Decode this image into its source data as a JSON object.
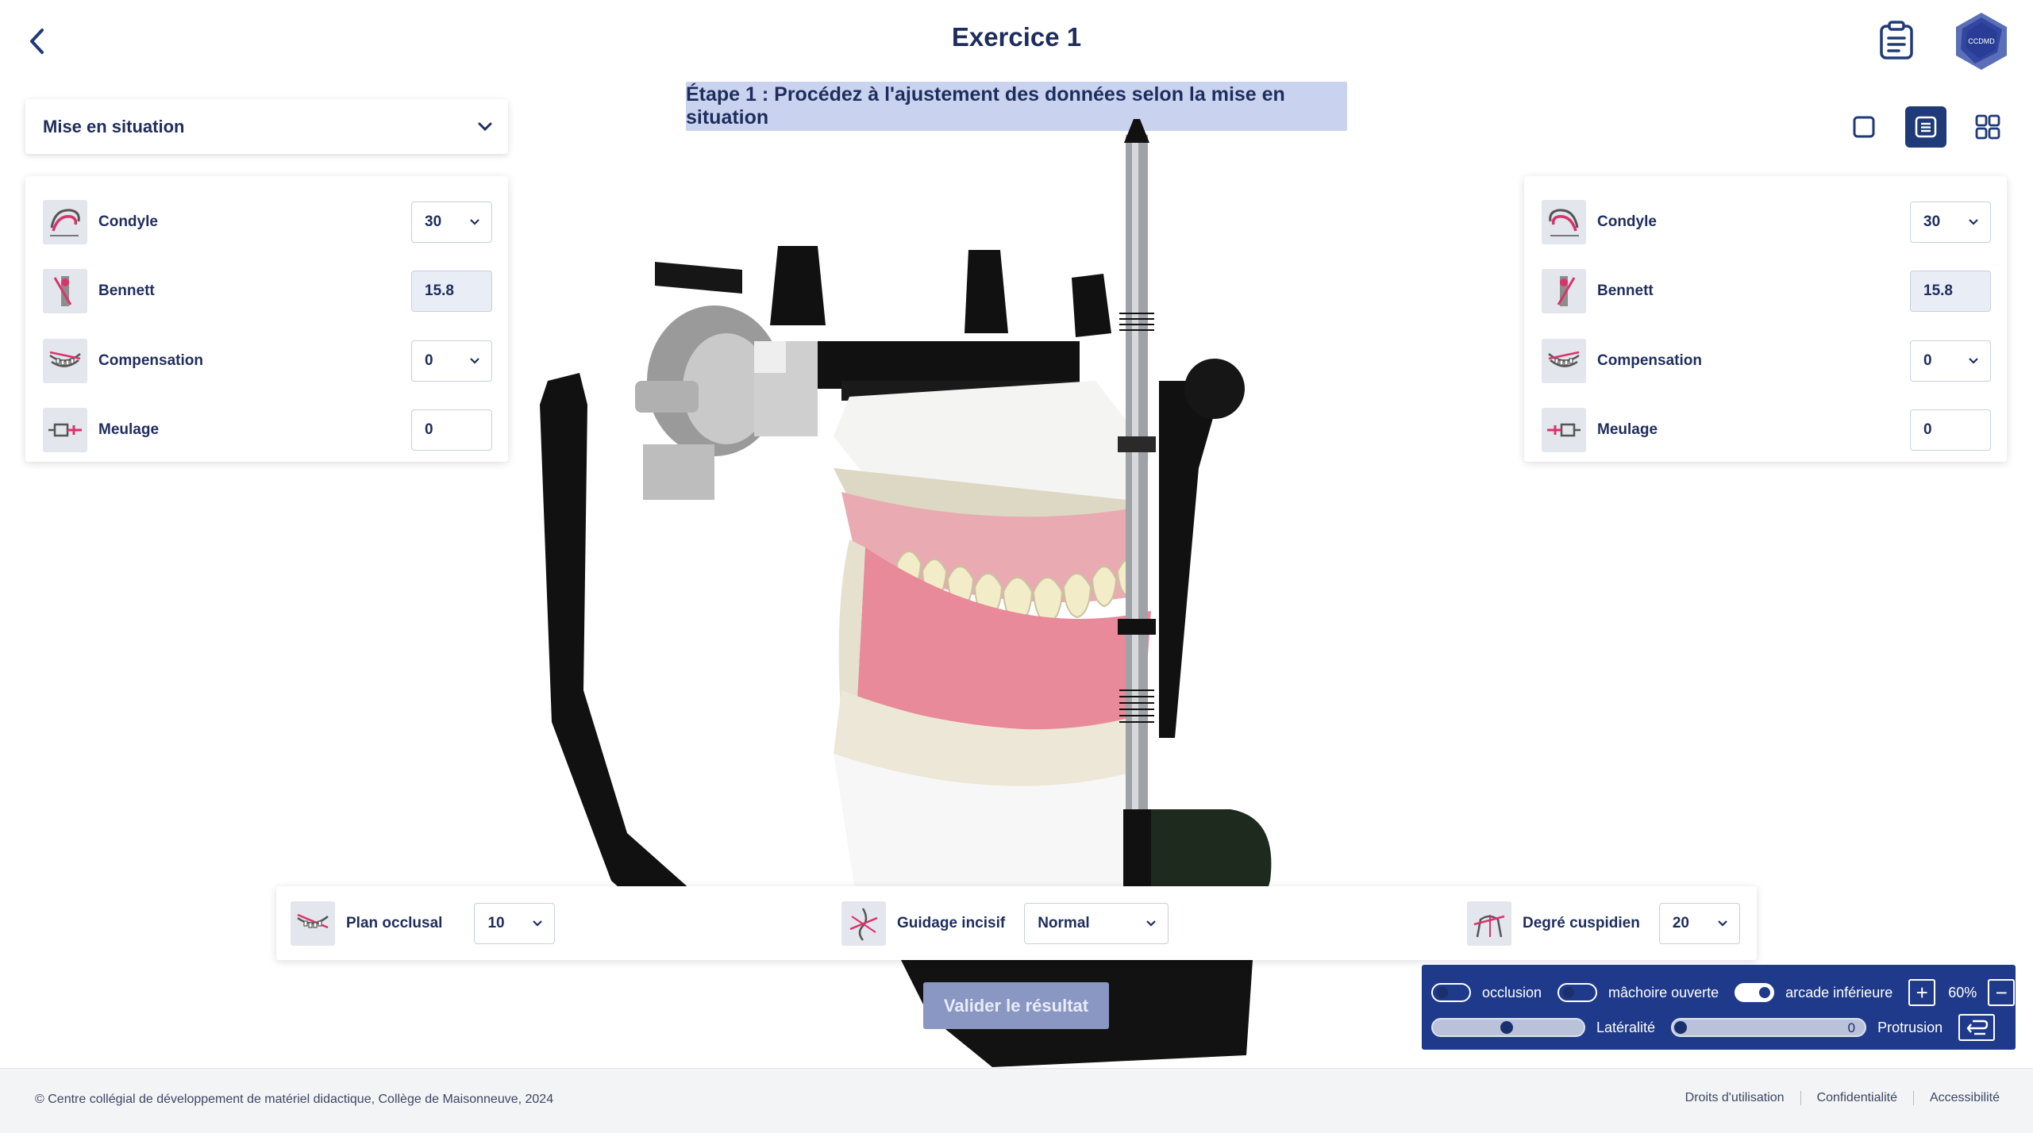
{
  "header": {
    "title": "Exercice 1",
    "logo_text": "CCDMD"
  },
  "step_banner": "Étape 1 : Procédez à l'ajustement des données selon la mise en situation",
  "situation_dropdown": {
    "label": "Mise en situation"
  },
  "left_panel": {
    "condyle": {
      "label": "Condyle",
      "value": "30"
    },
    "bennett": {
      "label": "Bennett",
      "value": "15.8"
    },
    "compensation": {
      "label": "Compensation",
      "value": "0"
    },
    "meulage": {
      "label": "Meulage",
      "value": "0"
    }
  },
  "right_panel": {
    "condyle": {
      "label": "Condyle",
      "value": "30"
    },
    "bennett": {
      "label": "Bennett",
      "value": "15.8"
    },
    "compensation": {
      "label": "Compensation",
      "value": "0"
    },
    "meulage": {
      "label": "Meulage",
      "value": "0"
    }
  },
  "bottom_bar": {
    "plan_occlusal": {
      "label": "Plan occlusal",
      "value": "10"
    },
    "guidage_incisif": {
      "label": "Guidage incisif",
      "value": "Normal"
    },
    "degre_cuspidien": {
      "label": "Degré cuspidien",
      "value": "20"
    }
  },
  "validate_button": "Valider le résultat",
  "controls": {
    "occlusion": {
      "label": "occlusion",
      "on": false
    },
    "machoire_ouverte": {
      "label": "mâchoire ouverte",
      "on": false
    },
    "arcade_inferieure": {
      "label": "arcade inférieure",
      "on": true
    },
    "zoom_plus": "+",
    "zoom_value": "60%",
    "zoom_minus": "−",
    "lateralite": {
      "label": "Latéralité",
      "level": 0.5
    },
    "protrusion": {
      "label": "Protrusion",
      "value": "0",
      "level": 0.0
    }
  },
  "footer": {
    "copyright": "© Centre collégial de développement de matériel didactique, Collège de Maisonneuve, 2024",
    "links": [
      "Droits d'utilisation",
      "Confidentialité",
      "Accessibilité"
    ]
  },
  "colors": {
    "primary": "#1f3a8a",
    "text": "#1f2d5c",
    "banner": "#c9d3f0",
    "accent_pink": "#d9336b"
  }
}
